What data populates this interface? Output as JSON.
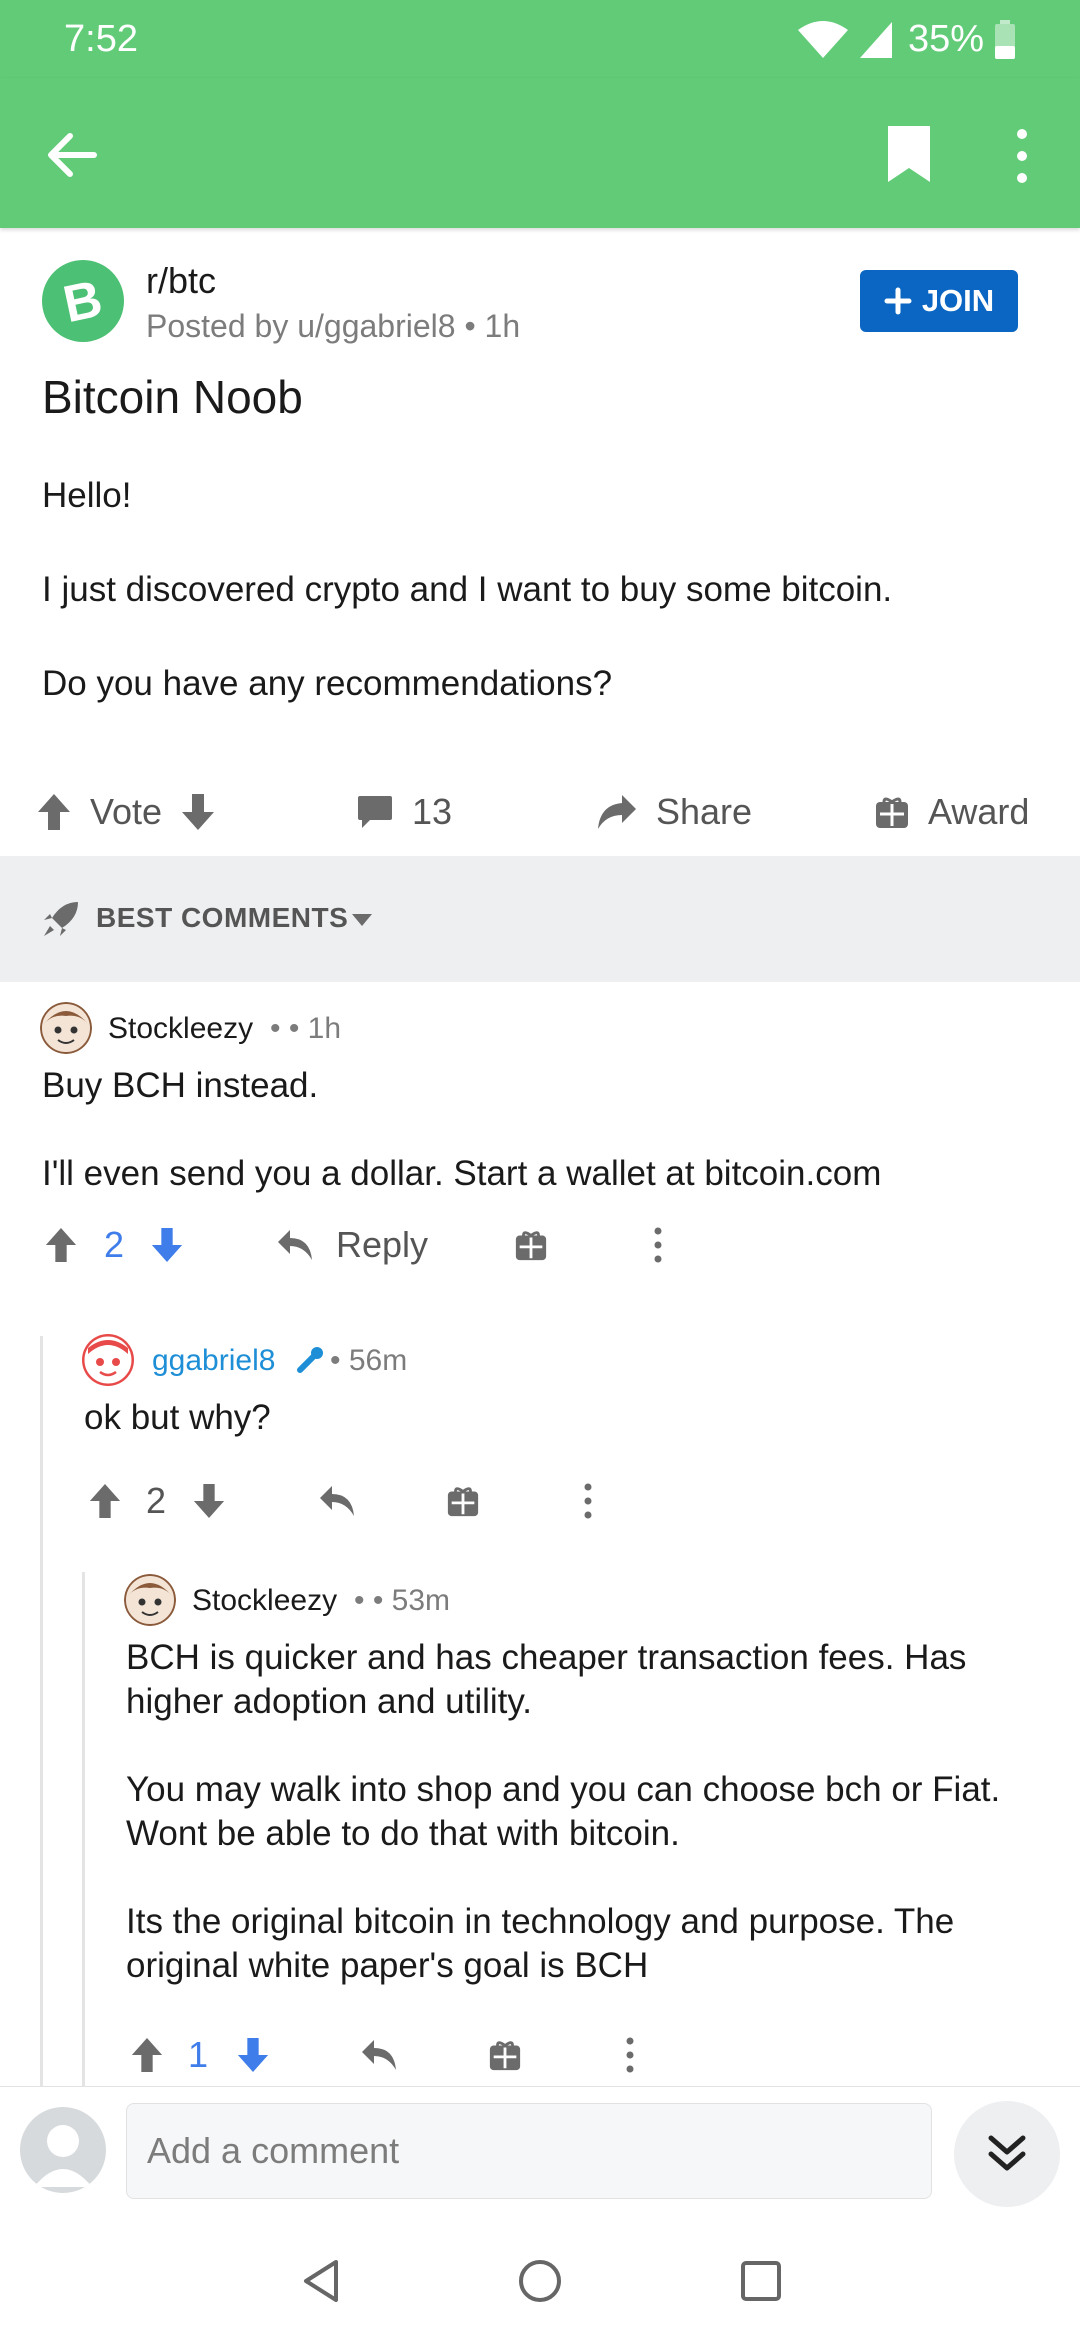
{
  "status_bar": {
    "time": "7:52",
    "battery": "35%"
  },
  "post": {
    "subreddit": "r/btc",
    "meta": "Posted by u/ggabriel8 • 1h",
    "join_label": "JOIN",
    "title": "Bitcoin Noob",
    "body": [
      "Hello!",
      "I just discovered crypto and I want to buy some bitcoin.",
      "Do you have any recommendations?"
    ],
    "vote_label": "Vote",
    "comments_count": "13",
    "share_label": "Share",
    "award_label": "Award"
  },
  "sort": {
    "label": "BEST COMMENTS"
  },
  "comments": [
    {
      "author": "Stockleezy",
      "meta": "•  • 1h",
      "body": [
        "Buy BCH instead.",
        "I'll even send you a dollar.   Start a wallet at bitcoin.com"
      ],
      "score": "2",
      "reply_label": "Reply"
    },
    {
      "author": "ggabriel8",
      "meta": "• 56m",
      "body": [
        "ok but why?"
      ],
      "score": "2"
    },
    {
      "author": "Stockleezy",
      "meta": "•  • 53m",
      "body": [
        "BCH is quicker and has cheaper transaction fees. Has higher adoption and utility.",
        "You may walk into shop and you can choose bch or Fiat. Wont be able to do that with bitcoin.",
        "Its the original bitcoin in technology and purpose. The original white paper's goal is BCH"
      ],
      "score": "1"
    }
  ],
  "compose": {
    "placeholder": "Add a comment"
  },
  "colors": {
    "header_green": "#61cb78",
    "join_blue": "#0a66c2",
    "upvote_blue": "#3f7dea",
    "op_blue": "#1e8fd6"
  }
}
